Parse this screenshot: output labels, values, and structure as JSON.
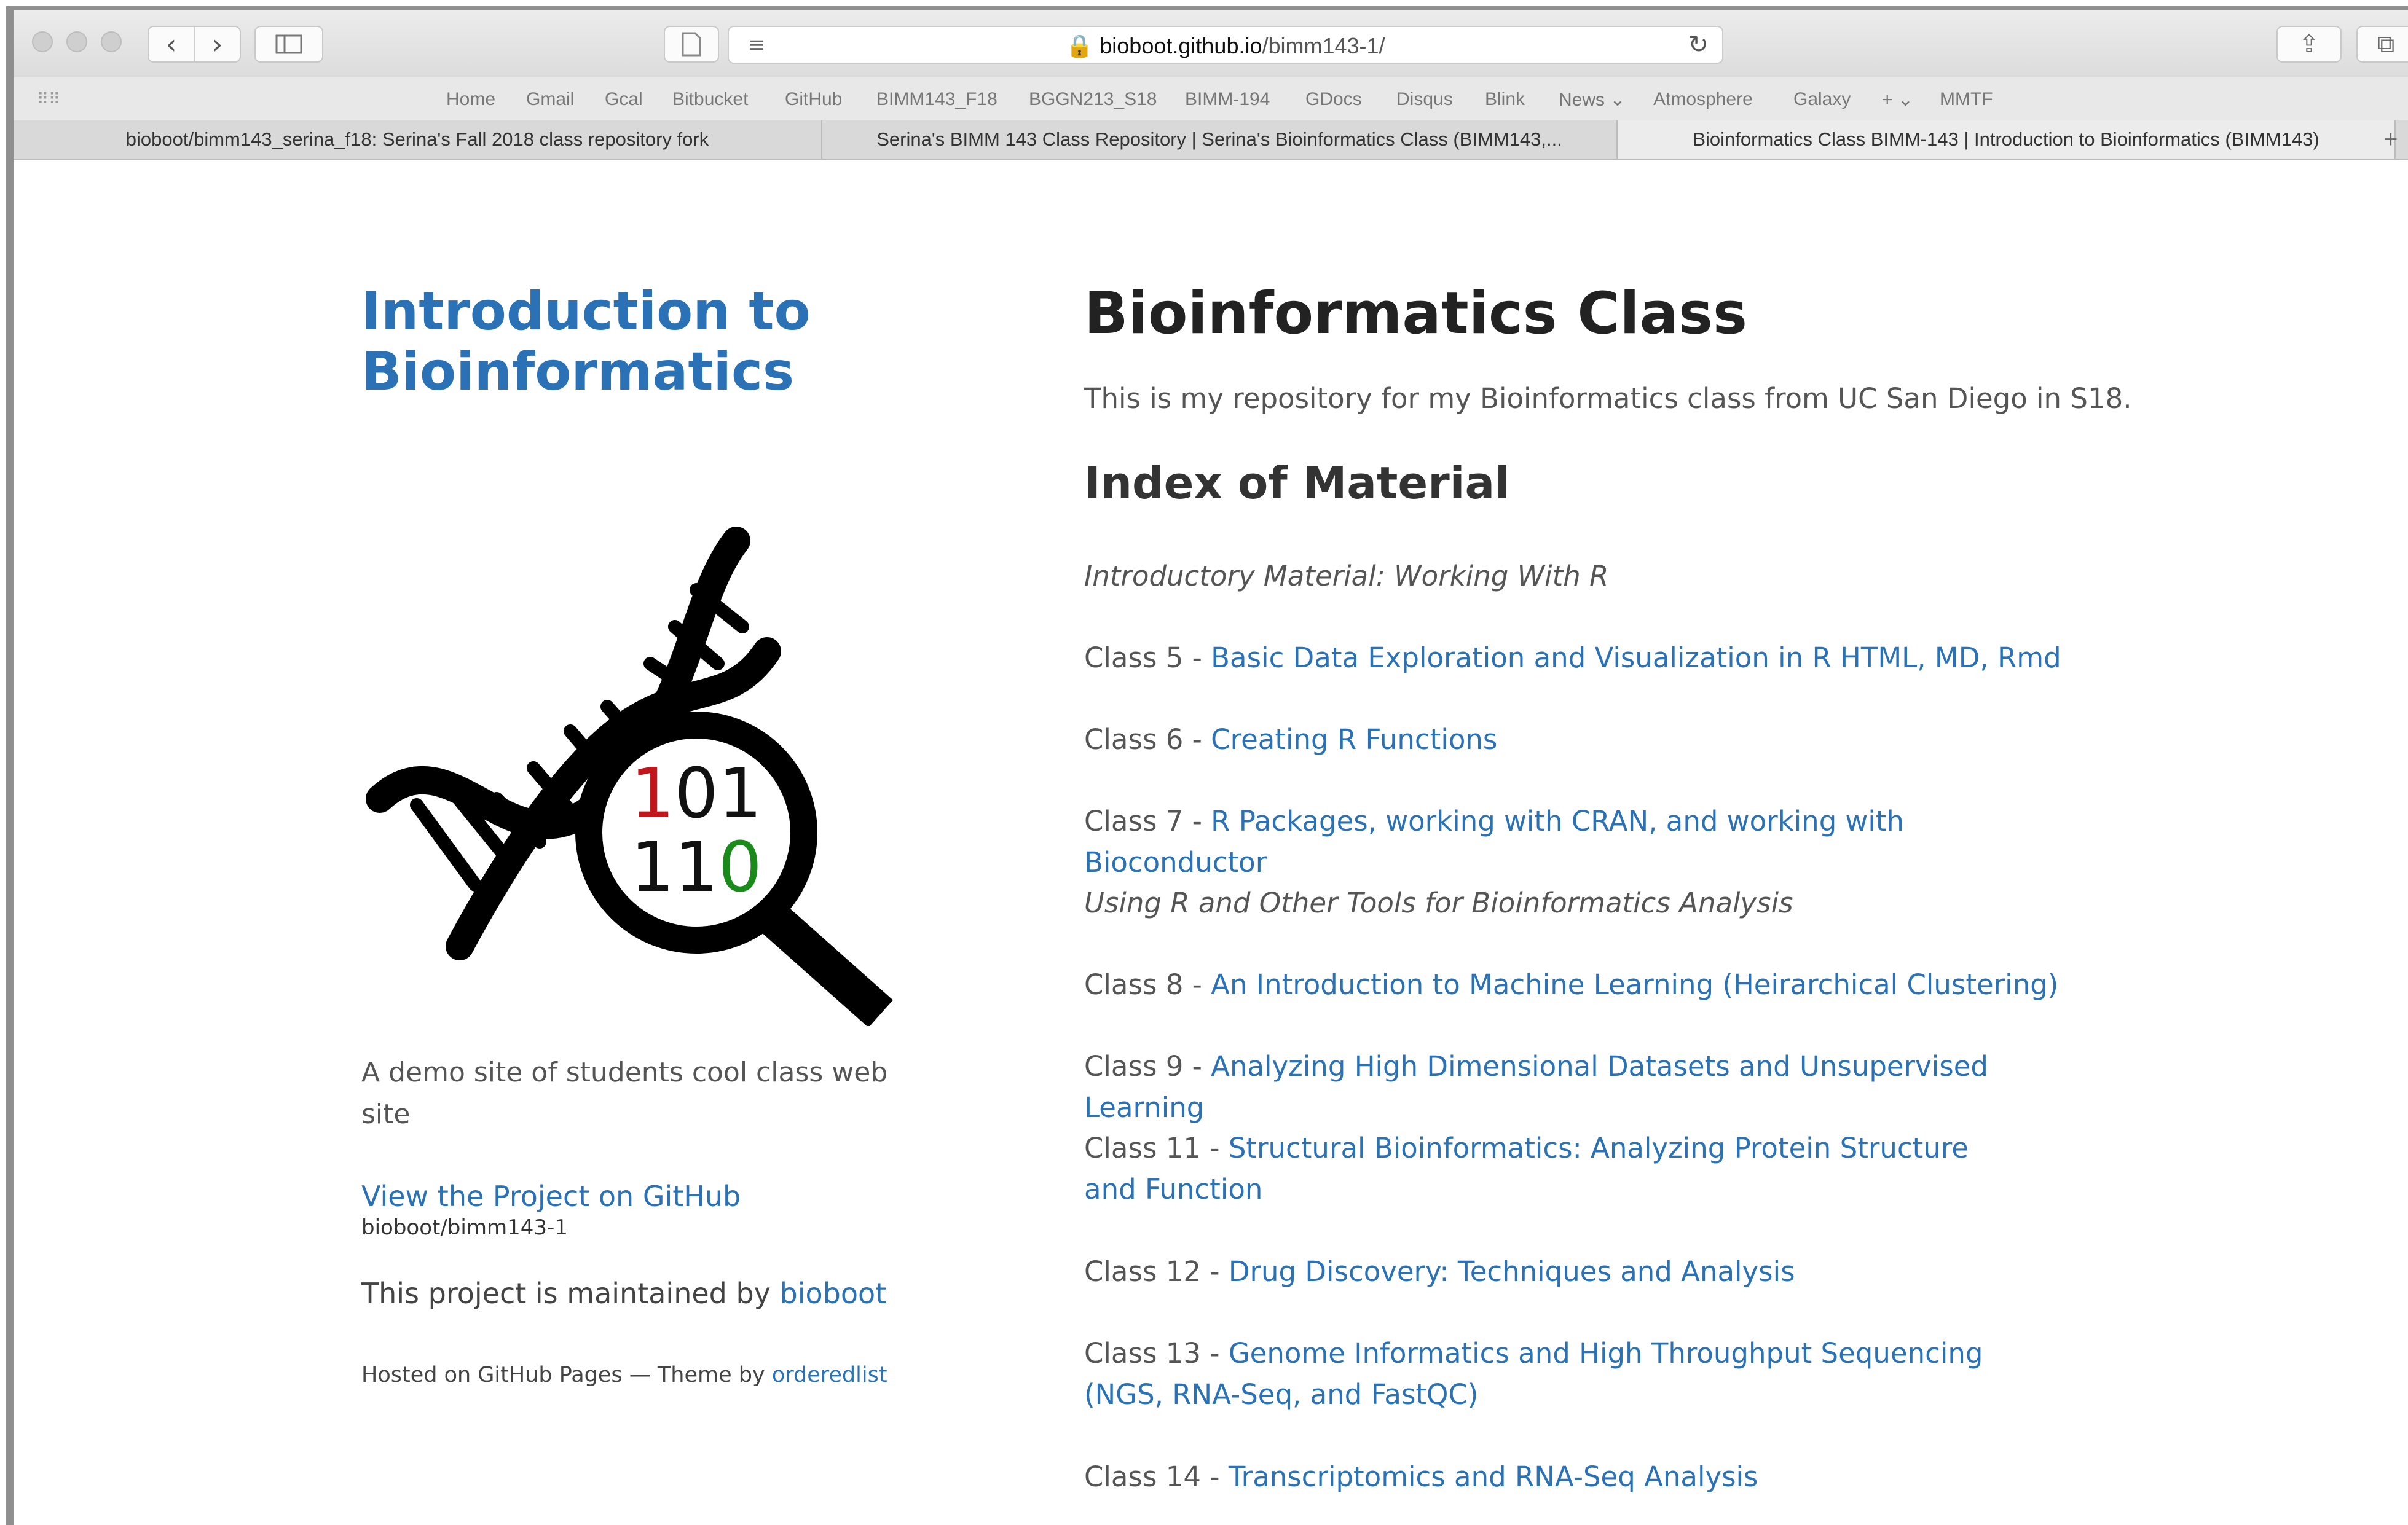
{
  "browser": {
    "url_host": "bioboot.github.io",
    "url_path": "/bimm143-1/",
    "favorites": [
      "Home",
      "Gmail",
      "Gcal",
      "Bitbucket",
      "GitHub",
      "BIMM143_F18",
      "BGGN213_S18",
      "BIMM-194",
      "GDocs",
      "Disqus",
      "Blink",
      "News",
      "Atmosphere",
      "Galaxy",
      "+",
      "MMTF"
    ],
    "tabs": [
      "bioboot/bimm143_serina_f18: Serina's Fall 2018 class repository fork",
      "Serina's BIMM 143 Class Repository | Serina's Bioinformatics Class (BIMM143,...",
      "Bioinformatics Class BIMM-143 | Introduction to Bioinformatics (BIMM143)"
    ],
    "icons": [
      "back-icon",
      "forward-icon",
      "sidebar-icon",
      "reader-icon",
      "lock-icon",
      "reload-icon",
      "share-icon",
      "tabs-overview-icon",
      "apps-grid-icon",
      "chevron-down-icon",
      "new-tab-icon"
    ]
  },
  "sidebar": {
    "title": "Introduction to Bioinformatics",
    "logo": {
      "digits_row1": "101",
      "digits_row2": "110",
      "highlight_red": "#c0161c",
      "highlight_green": "#1a8a1a"
    },
    "tagline": "A demo site of students cool class web site",
    "github_link": "View the Project on GitHub",
    "github_repo": "bioboot/bimm143-1",
    "maintained_prefix": "This project is maintained by",
    "maintained_user": "bioboot",
    "hosted_prefix": "Hosted on GitHub Pages — Theme by",
    "theme_author": "orderedlist"
  },
  "main": {
    "title": "Bioinformatics Class",
    "intro": "This is my repository for my Bioinformatics class from UC San Diego in S18.",
    "index_title": "Index of Material",
    "items": [
      {
        "type": "section",
        "text": "Introductory Material: Working With R"
      },
      {
        "type": "class",
        "label": "Class 5 - ",
        "link": "Basic Data Exploration and Visualization in R",
        "extra_links": [
          "HTML",
          "MD",
          "Rmd"
        ]
      },
      {
        "type": "class",
        "label": "Class 6 - ",
        "link": "Creating R Functions"
      },
      {
        "type": "class",
        "label": "Class 7 - ",
        "link": "R Packages, working with CRAN, and working with Bioconductor"
      },
      {
        "type": "section",
        "text": "Using R and Other Tools for Bioinformatics Analysis"
      },
      {
        "type": "class",
        "label": "Class 8 - ",
        "link": "An Introduction to Machine Learning (Heirarchical Clustering)"
      },
      {
        "type": "class",
        "label": "Class 9 - ",
        "link": "Analyzing High Dimensional Datasets and Unsupervised Learning"
      },
      {
        "type": "class",
        "label": "Class 11 - ",
        "link": "Structural Bioinformatics: Analyzing Protein Structure and Function"
      },
      {
        "type": "class",
        "label": "Class 12 - ",
        "link": "Drug Discovery: Techniques and Analysis"
      },
      {
        "type": "class",
        "label": "Class 13 - ",
        "link": "Genome Informatics and High Throughput Sequencing (NGS, RNA-Seq, and FastQC)"
      },
      {
        "type": "class",
        "label": "Class 14 - ",
        "link": "Transcriptomics and RNA-Seq Analysis"
      }
    ]
  },
  "colors": {
    "link": "#2a72b5",
    "heading": "#222222",
    "text": "#555555"
  }
}
